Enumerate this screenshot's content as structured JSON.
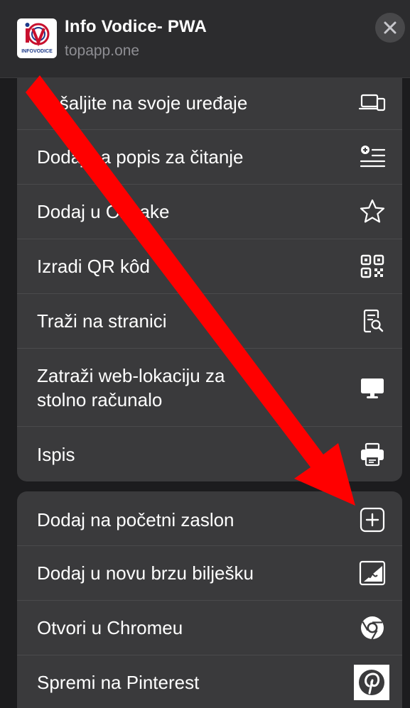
{
  "header": {
    "app_title": "Info Vodice- PWA",
    "app_url": "topapp.one",
    "logo_text": "INFOVODICE"
  },
  "menu_group_1": [
    {
      "label": "Pošaljite na svoje uređaje",
      "icon": "devices-icon"
    },
    {
      "label": "Dodaj na popis za čitanje",
      "icon": "reading-list-icon"
    },
    {
      "label": "Dodaj u Oznake",
      "icon": "star-icon"
    },
    {
      "label": "Izradi QR kôd",
      "icon": "qr-code-icon"
    },
    {
      "label": "Traži na stranici",
      "icon": "find-in-page-icon"
    },
    {
      "label": "Zatraži web-lokaciju za\nstolno računalo",
      "icon": "desktop-icon"
    },
    {
      "label": "Ispis",
      "icon": "printer-icon"
    }
  ],
  "menu_group_2": [
    {
      "label": "Dodaj na početni zaslon",
      "icon": "add-square-icon"
    },
    {
      "label": "Dodaj u novu brzu bilješku",
      "icon": "quick-note-icon"
    },
    {
      "label": "Otvori u Chromeu",
      "icon": "chrome-icon"
    },
    {
      "label": "Spremi na Pinterest",
      "icon": "pinterest-icon"
    }
  ],
  "colors": {
    "background": "#1c1c1e",
    "row_background": "#3a3a3c",
    "arrow": "#ff0000",
    "secondary_text": "#8e8e93"
  }
}
